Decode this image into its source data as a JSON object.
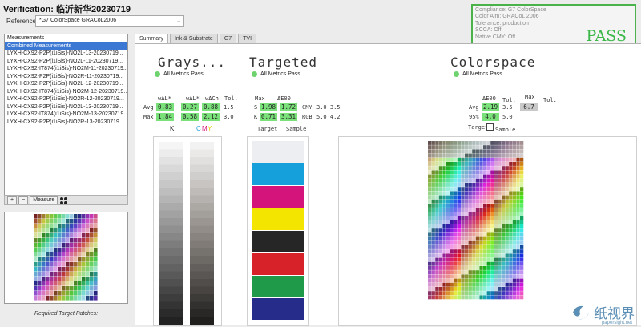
{
  "title": "Verification: 临沂新华20230719",
  "reference": {
    "label": "Reference",
    "value": "*G7 ColorSpace GRACoL2006"
  },
  "compliance": {
    "lines": [
      "Compliance: G7 ColorSpace",
      "Color Aim: GRACoL 2006",
      "Tolerance: production",
      "SCCA: Off",
      "Native CMY: Off"
    ],
    "status": "PASS",
    "status_color": "#3cb84a"
  },
  "measurements": {
    "header": "Measurements",
    "items": [
      "Combined Measurements",
      "LYXH-CX92-P2P(i1iSis)-NO2L-13-20230719...",
      "LYXH-CX92-P2P(i1iSis)-NO2L-11-20230719...",
      "LYXH-CX92-IT874(i1iSis)-NO2M-11-20230719...",
      "LYXH-CX92-P2P(i1iSis)-NO2R-11-20230719...",
      "LYXH-CX92-P2P(i1iSis)-NO2L-12-20230719...",
      "LYXH-CX92-IT874(i1iSis)-NO2M-12-20230719...",
      "LYXH-CX92-P2P(i1iSis)-NO2R-12-20230719...",
      "LYXH-CX92-P2P(i1iSis)-NO2L-13-20230719...",
      "LYXH-CX92-IT874(i1iSis)-NO2M-13-20230719...",
      "LYXH-CX92-P2P(i1iSis)-NO2R-13-20230719..."
    ],
    "selected_index": 0,
    "add": "+",
    "remove": "−",
    "measure": "Measure"
  },
  "required_label": "Required Target Patches:",
  "tabs": [
    "Summary",
    "Ink & Substrate",
    "G7",
    "TVI"
  ],
  "active_tab": 0,
  "grays": {
    "title": "Grays...",
    "pass": "All Metrics Pass",
    "headers": [
      "wΔL*",
      "wΔL*",
      "wΔCh",
      "Tol."
    ],
    "rows": [
      {
        "label": "Avg",
        "values": [
          "0.83",
          "0.27",
          "0.88"
        ],
        "tol": "1.5"
      },
      {
        "label": "Max",
        "values": [
          "1.84",
          "0.58",
          "2.12"
        ],
        "tol": "3.0"
      }
    ],
    "ramp_labels": [
      "K",
      "C",
      "M",
      "Y"
    ]
  },
  "targeted": {
    "title": "Targeted",
    "pass": "All Metrics Pass",
    "headers": [
      "Max",
      "ΔE00"
    ],
    "rows": [
      {
        "label": "S",
        "values": [
          "1.98",
          "1.72"
        ],
        "tag": "CMY",
        "tol": "3.0 3.5"
      },
      {
        "label": "K",
        "values": [
          "0.71",
          "3.31"
        ],
        "tag": "RGB",
        "tol": "5.0 4.2"
      }
    ],
    "legend": [
      "Target",
      "Sample"
    ]
  },
  "colorspace": {
    "title": "Colorspace",
    "pass": "All Metrics Pass",
    "headers": [
      "ΔE00",
      "Tol.",
      "Max",
      "Tol."
    ],
    "rows": [
      {
        "label": "Avg",
        "value": "2.19",
        "tol": "3.5"
      },
      {
        "label": "95%",
        "value": "4.0",
        "tol": "5.0"
      }
    ],
    "max_value": "6.7",
    "legend": [
      "Target",
      "Sample"
    ]
  },
  "watermark": {
    "text": "纸视界",
    "url": "papersight.net"
  }
}
